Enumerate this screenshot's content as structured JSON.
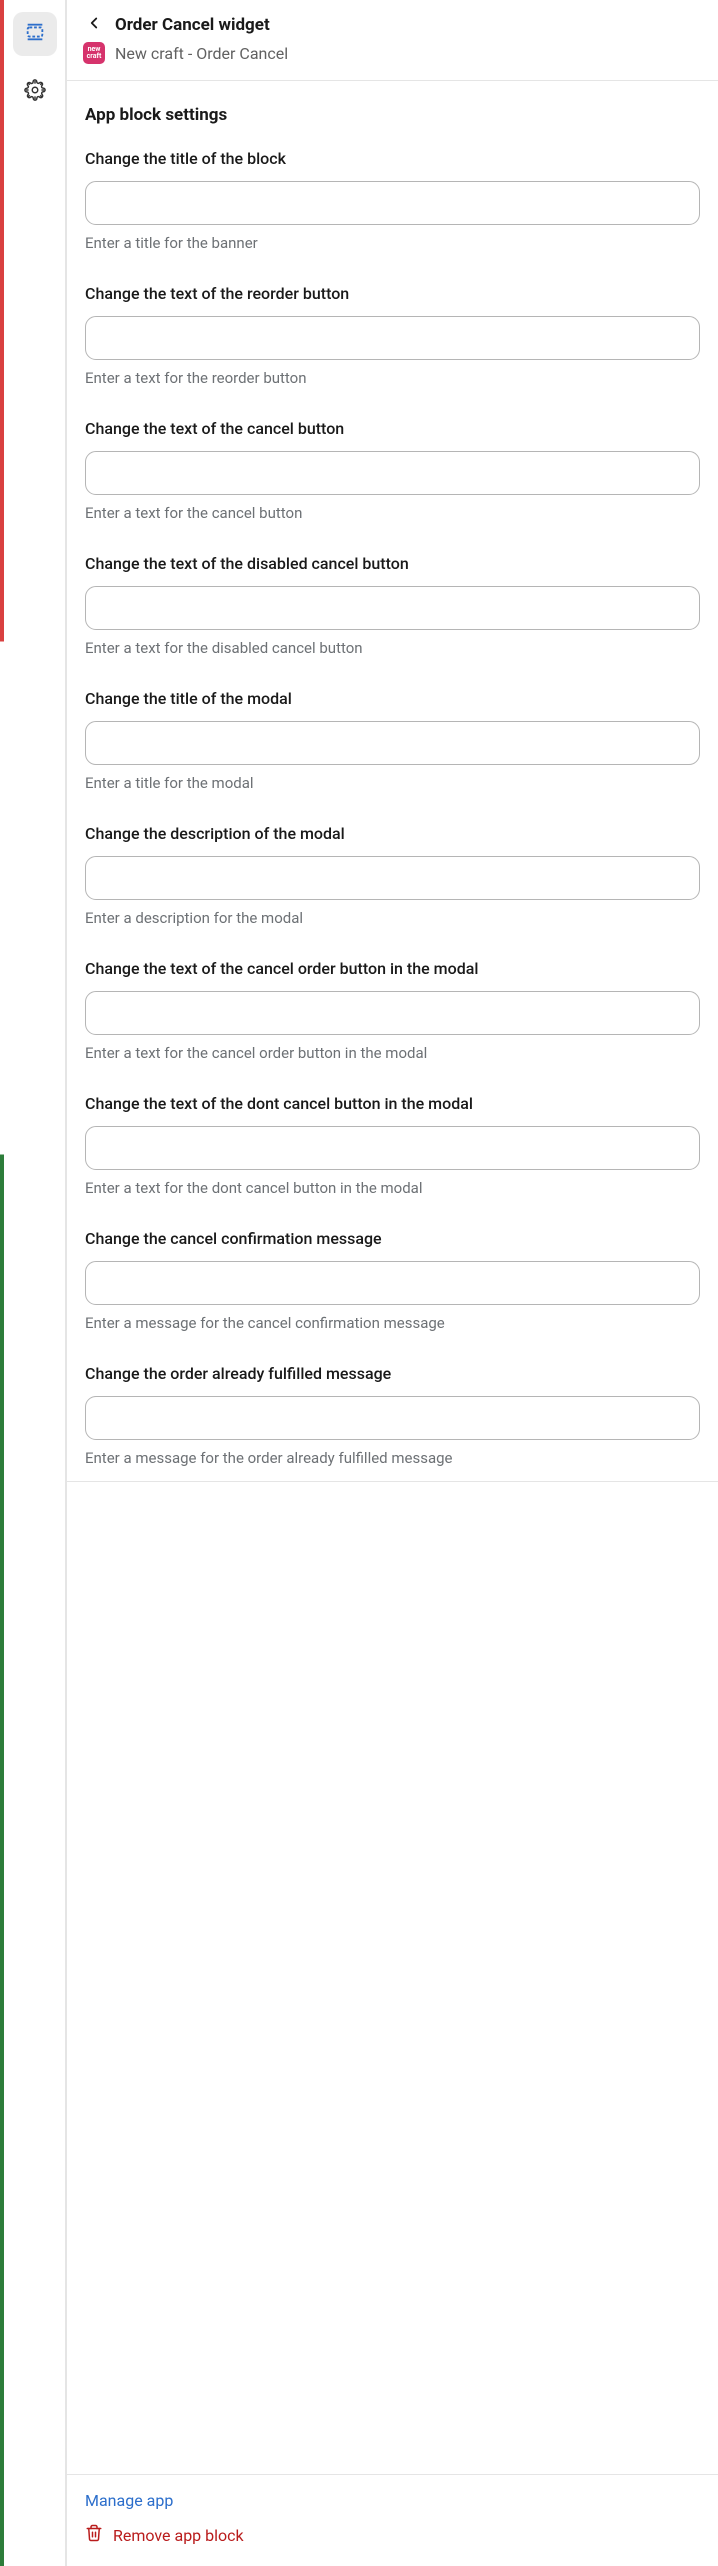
{
  "sidebar": {
    "sections_label": "sections",
    "settings_label": "settings"
  },
  "header": {
    "title": "Order Cancel widget",
    "app_name": "New craft - Order Cancel",
    "app_icon_top": "new",
    "app_icon_bottom": "craft"
  },
  "section_title": "App block settings",
  "fields": [
    {
      "label": "Change the title of the block",
      "value": "",
      "help": "Enter a title for the banner"
    },
    {
      "label": "Change the text of the reorder button",
      "value": "",
      "help": "Enter a text for the reorder button"
    },
    {
      "label": "Change the text of the cancel button",
      "value": "",
      "help": "Enter a text for the cancel button"
    },
    {
      "label": "Change the text of the disabled cancel button",
      "value": "",
      "help": "Enter a text for the disabled cancel button"
    },
    {
      "label": "Change the title of the modal",
      "value": "",
      "help": "Enter a title for the modal"
    },
    {
      "label": "Change the description of the modal",
      "value": "",
      "help": "Enter a description for the modal"
    },
    {
      "label": "Change the text of the cancel order button in the modal",
      "value": "",
      "help": "Enter a text for the cancel order button in the modal"
    },
    {
      "label": "Change the text of the dont cancel button in the modal",
      "value": "",
      "help": "Enter a text for the dont cancel button in the modal"
    },
    {
      "label": "Change the cancel confirmation message",
      "value": "",
      "help": "Enter a message for the cancel confirmation message"
    },
    {
      "label": "Change the order already fulfilled message",
      "value": "",
      "help": "Enter a message for the order already fulfilled message"
    }
  ],
  "footer": {
    "manage_label": "Manage app",
    "remove_label": "Remove app block"
  }
}
